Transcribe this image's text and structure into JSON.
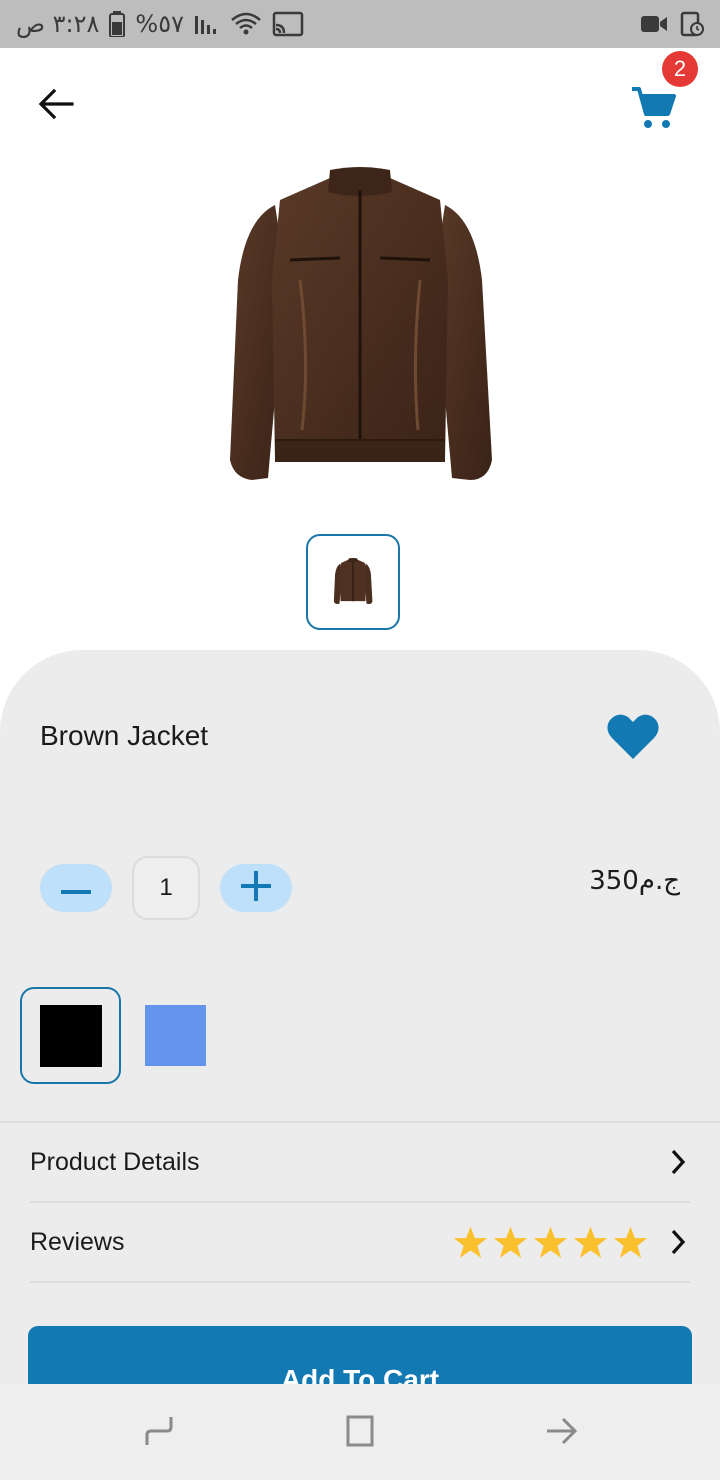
{
  "status_bar": {
    "time": "٣:٢٨ ص",
    "battery": "%٥٧",
    "icons": [
      "battery-icon",
      "signal-icon",
      "wifi-icon",
      "cast-icon",
      "video-recording-icon",
      "screen-timer-icon"
    ]
  },
  "header": {
    "back_icon": "arrow-back-icon",
    "cart_icon": "shopping-cart-icon",
    "cart_count": "2"
  },
  "product": {
    "title": "Brown Jacket",
    "price": "ج.م350",
    "quantity": "1",
    "favorite": true,
    "colors": [
      "#000000",
      "#6495ed"
    ],
    "selected_color_index": 0
  },
  "rows": {
    "details_label": "Product Details",
    "reviews_label": "Reviews",
    "rating": 5
  },
  "cta": {
    "label": "Add To Cart"
  },
  "colors": {
    "accent": "#1279b3",
    "badge": "#e53935",
    "star": "#fbc02d",
    "qty_button_bg": "#bfe0fb"
  },
  "nav": {
    "icons": [
      "recent-apps-icon",
      "home-icon",
      "back-nav-icon"
    ]
  }
}
